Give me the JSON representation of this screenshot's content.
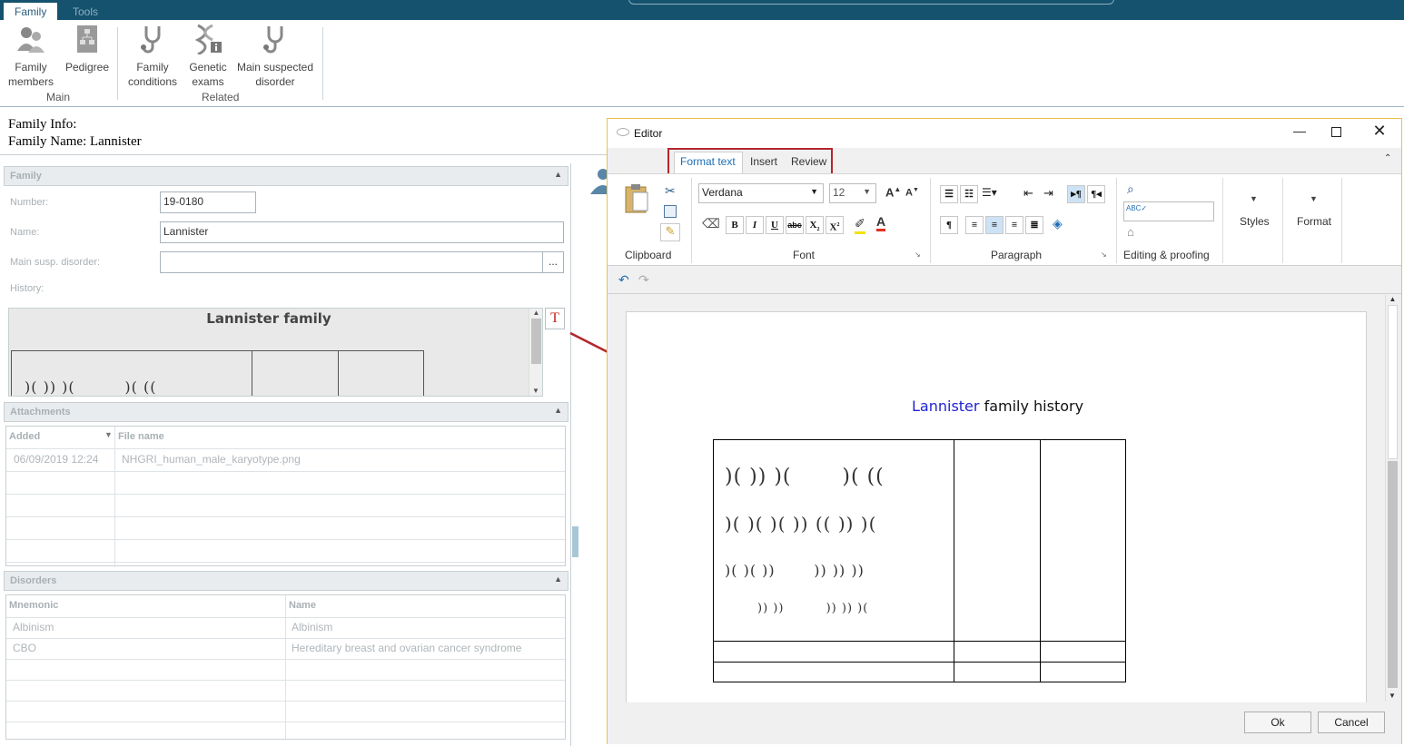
{
  "topbar": {
    "tabs": [
      "Family",
      "Tools"
    ]
  },
  "ribbon": {
    "buttons": [
      {
        "label": "Family members",
        "line1": "Family",
        "line2": "members",
        "icon": "people-icon"
      },
      {
        "label": "Pedigree",
        "line1": "Pedigree",
        "line2": "",
        "icon": "pedigree-icon"
      },
      {
        "label": "Family conditions",
        "line1": "Family",
        "line2": "conditions",
        "icon": "stethoscope-icon"
      },
      {
        "label": "Genetic exams",
        "line1": "Genetic",
        "line2": "exams",
        "icon": "dna-icon"
      },
      {
        "label": "Main suspected disorder",
        "line1": "Main suspected",
        "line2": "disorder",
        "icon": "stethoscope-icon"
      }
    ],
    "groups": [
      "Main",
      "Related"
    ]
  },
  "info": {
    "line1": "Family Info:",
    "line2": "Family Name: Lannister"
  },
  "family_panel": {
    "header": "Family",
    "number_label": "Number:",
    "number_value": "19-0180",
    "name_label": "Name:",
    "name_value": "Lannister",
    "disorder_label": "Main susp. disorder:",
    "disorder_value": "",
    "browse_label": "...",
    "history_label": "History:",
    "history_preview_title": "Lannister family"
  },
  "attachments": {
    "header": "Attachments",
    "columns": [
      "Added",
      "File name"
    ],
    "rows": [
      {
        "added": "06/09/2019 12:24",
        "file": "NHGRI_human_male_karyotype.png"
      }
    ]
  },
  "disorders": {
    "header": "Disorders",
    "columns": [
      "Mnemonic",
      "Name"
    ],
    "rows": [
      {
        "mnemonic": "Albinism",
        "name": "Albinism"
      },
      {
        "mnemonic": "CBO",
        "name": "Hereditary breast and ovarian cancer syndrome"
      }
    ]
  },
  "editor": {
    "title": "Editor",
    "tabs": [
      "Format text",
      "Insert",
      "Review"
    ],
    "active_tab": "Format text",
    "font_name": "Verdana",
    "font_size": "12",
    "groups": [
      "Clipboard",
      "Font",
      "Paragraph",
      "Editing & proofing",
      "Styles",
      "Format"
    ],
    "doc_title_highlight": "Lannister",
    "doc_title_rest": " family history",
    "highlight_color": "#1f1fd6",
    "ok_label": "Ok",
    "cancel_label": "Cancel"
  },
  "colors": {
    "topbar": "#14526e",
    "annotation_red": "#b3262b",
    "editor_border": "#e8c34a"
  }
}
